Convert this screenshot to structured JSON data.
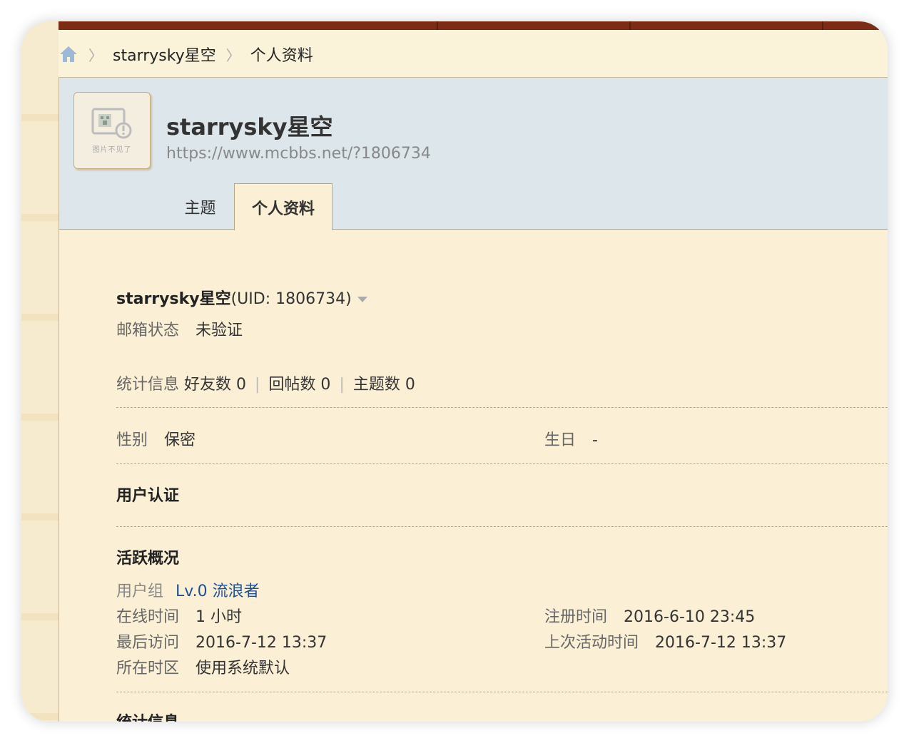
{
  "breadcrumb": {
    "items": [
      "starrysky星空",
      "个人资料"
    ],
    "separator": "〉"
  },
  "profile": {
    "name": "starrysky星空",
    "url": "https://www.mcbbs.net/?1806734",
    "avatar_caption": "图片不见了"
  },
  "tabs": [
    {
      "label": "主题",
      "active": false
    },
    {
      "label": "个人资料",
      "active": true
    }
  ],
  "details": {
    "name_uid": "starrysky星空",
    "uid_text": "(UID: 1806734)",
    "email_label": "邮箱状态",
    "email_value": "未验证",
    "stats_label": "统计信息",
    "friends": "好友数 0",
    "replies": "回帖数 0",
    "threads": "主题数 0",
    "gender_label": "性别",
    "gender_value": "保密",
    "birthday_label": "生日",
    "birthday_value": "-",
    "verify_title": "用户认证",
    "activity_title": "活跃概况",
    "usergroup_label": "用户组",
    "usergroup_value": "Lv.0 流浪者",
    "online_label": "在线时间",
    "online_value": "1 小时",
    "register_label": "注册时间",
    "register_value": "2016-6-10 23:45",
    "last_visit_label": "最后访问",
    "last_visit_value": "2016-7-12 13:37",
    "last_active_label": "上次活动时间",
    "last_active_value": "2016-7-12 13:37",
    "timezone_label": "所在时区",
    "timezone_value": "使用系统默认",
    "stats_title": "统计信息"
  },
  "colors": {
    "page_bg": "#fbf2da",
    "header_bg": "#dde6ea",
    "top_bar": "#7c2b14",
    "link": "#1f4f8f"
  }
}
